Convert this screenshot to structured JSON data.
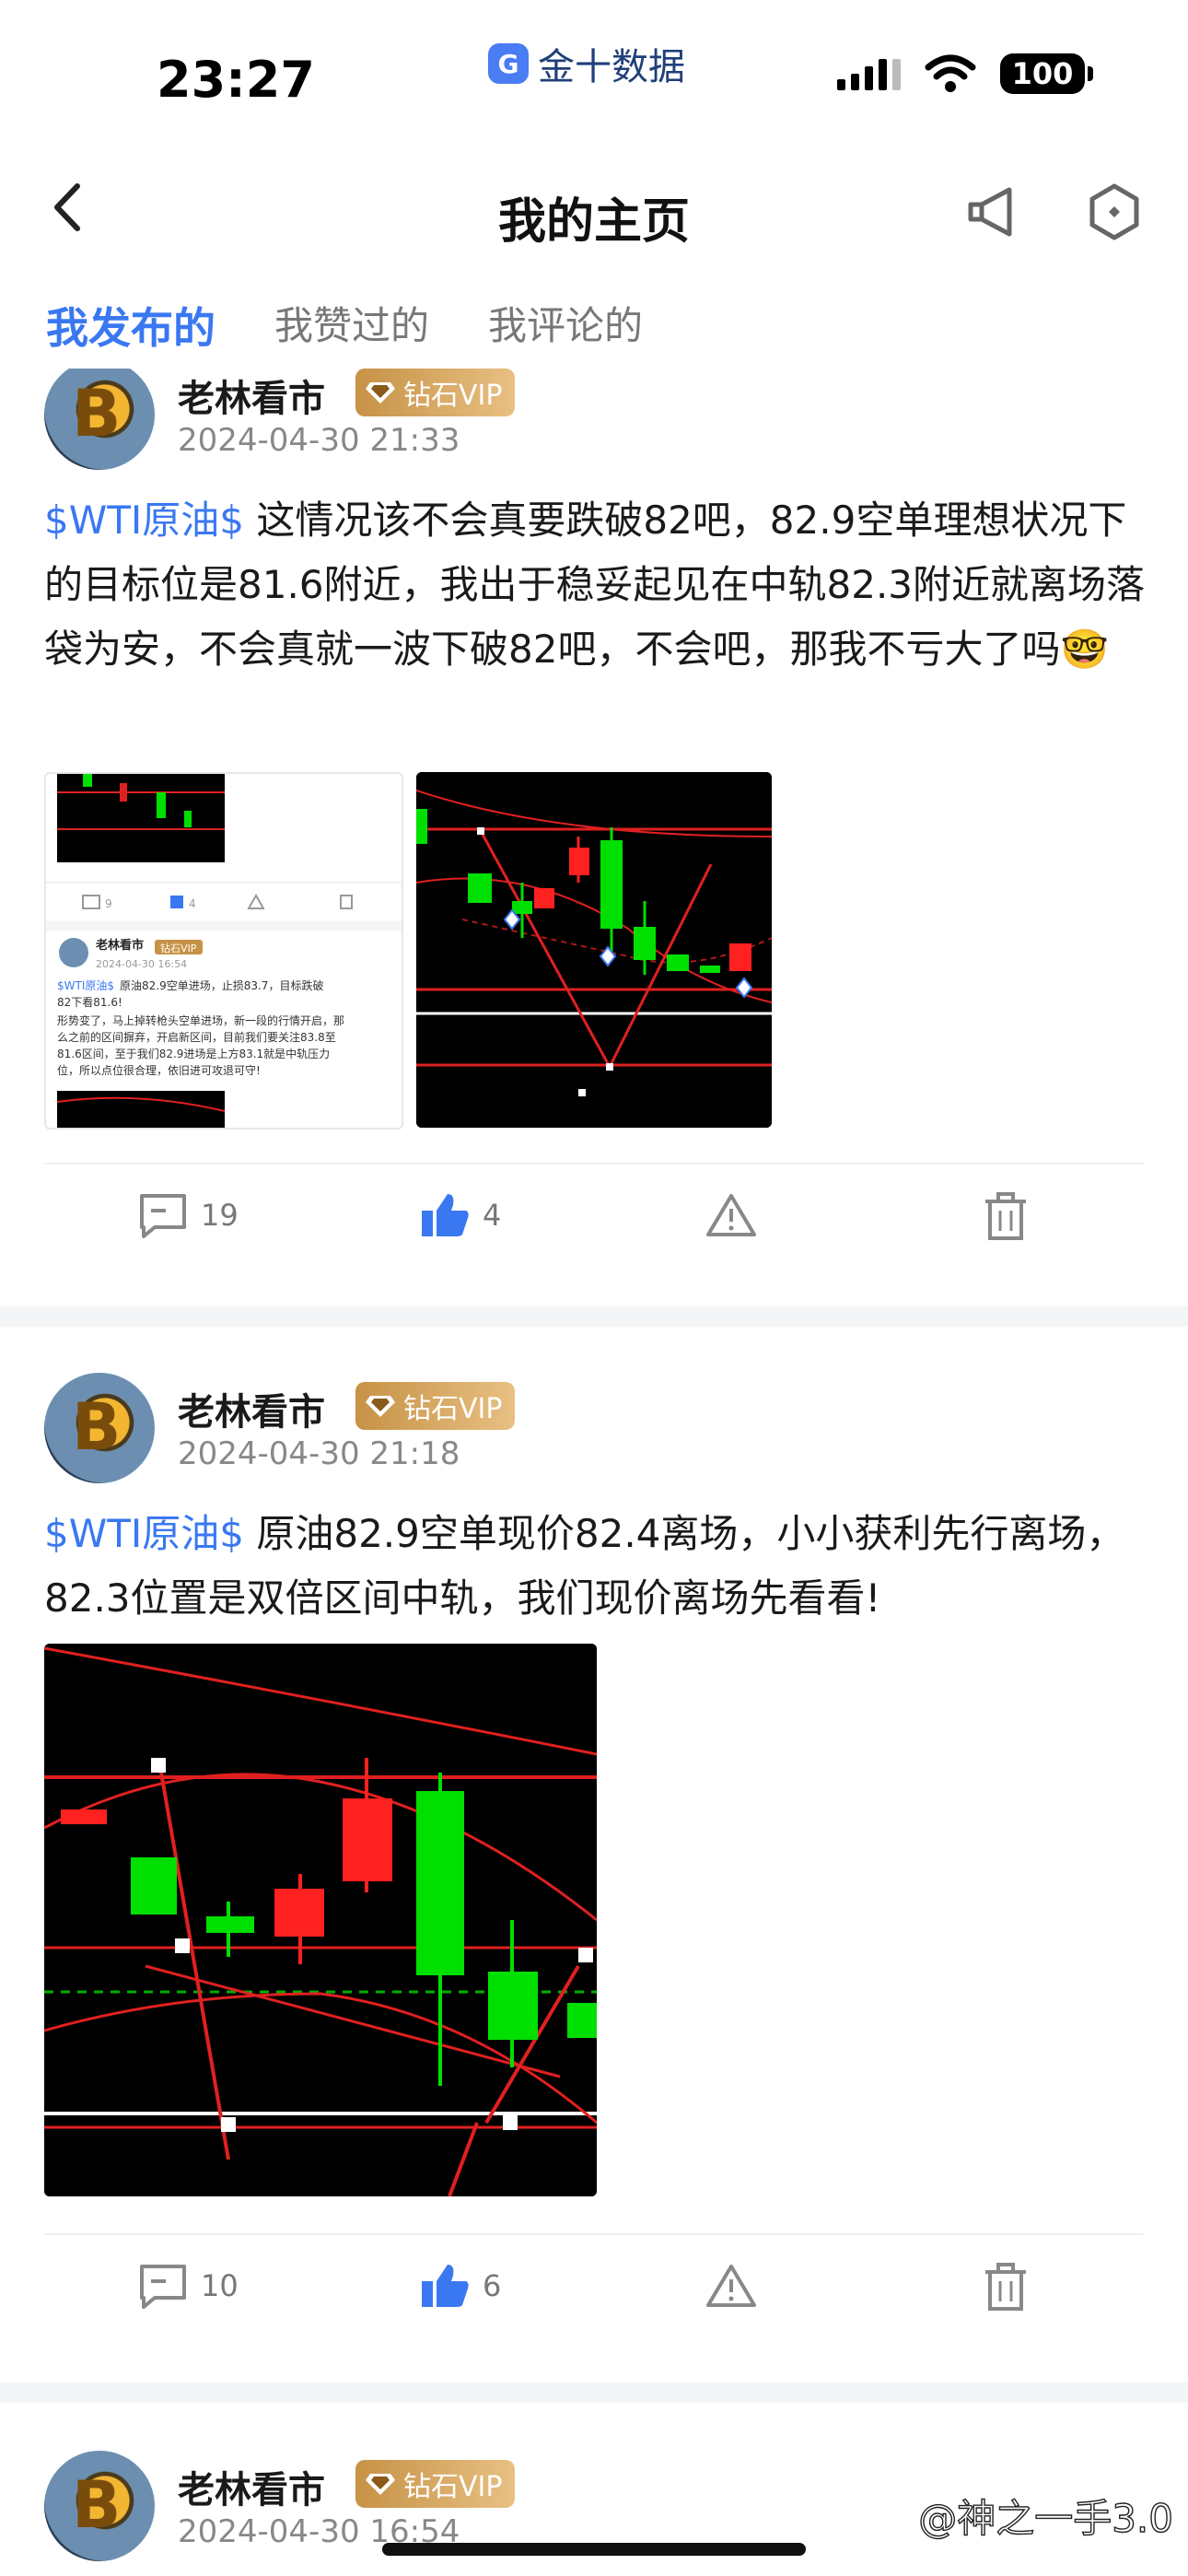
{
  "status_bar": {
    "time": "23:27",
    "app_name": "金十数据",
    "battery": "100"
  },
  "nav": {
    "title": "我的主页",
    "back_icon": "chevron-left-icon",
    "speaker_icon": "megaphone-icon",
    "settings_icon": "hexagon-settings-icon"
  },
  "tabs": [
    {
      "label": "我发布的",
      "active": true
    },
    {
      "label": "我赞过的",
      "active": false
    },
    {
      "label": "我评论的",
      "active": false
    }
  ],
  "posts": [
    {
      "author": "老林看市",
      "vip": "钻石VIP",
      "time": "2024-04-30 21:33",
      "tag": "$WTI原油$",
      "text": " 这情况该不会真要跌破82吧，82.9空单理想状况下的目标位是81.6附近，我出于稳妥起见在中轨82.3附近就离场落袋为安，不会真就一波下破82吧，不会吧，那我不亏大了吗🤓",
      "embed": {
        "author": "老林看市",
        "vip": "钻石VIP",
        "time": "2024-04-30 16:54",
        "tag": "$WTI原油$",
        "text": "原油82.9空单进场，止损83.7，目标跌破82下看81.6!",
        "text2": "形势变了，马上掉转枪头空单进场，新一段的行情开启，那么之前的区间摒弃，开启新区间，目前我们要关注83.8至81.6区间，至于我们82.9进场是上方83.1就是中轨压力位，所以点位很合理，依旧进可攻退可守!",
        "comments": "9",
        "likes": "4"
      },
      "comments": "19",
      "likes": "4"
    },
    {
      "author": "老林看市",
      "vip": "钻石VIP",
      "time": "2024-04-30 21:18",
      "tag": "$WTI原油$",
      "text": " 原油82.9空单现价82.4离场，小小获利先行离场，82.3位置是双倍区间中轨，我们现价离场先看看!",
      "comments": "10",
      "likes": "6"
    },
    {
      "author": "老林看市",
      "vip": "钻石VIP",
      "time": "2024-04-30 16:54"
    }
  ],
  "watermark": "@神之一手3.0",
  "colors": {
    "accent": "#3a78f2",
    "vip_gold": "#c69246",
    "candle_up": "#00ff00",
    "candle_down": "#ff2020"
  }
}
